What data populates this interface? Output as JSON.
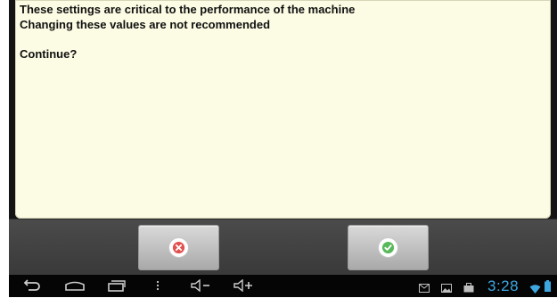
{
  "dialog": {
    "lines": [
      "These settings are critical to the performance of the machine",
      "Changing these values are not recommended"
    ],
    "question": "Continue?"
  },
  "buttons": {
    "cancel_icon": "cancel-x-icon",
    "confirm_icon": "confirm-check-icon"
  },
  "navbar": {
    "icons": [
      "back-icon",
      "home-icon",
      "recent-apps-icon",
      "menu-icon",
      "volume-down-icon",
      "volume-up-icon"
    ]
  },
  "status": {
    "time": "3:28",
    "icons": [
      "email-icon",
      "gallery-icon",
      "briefcase-icon",
      "wifi-icon",
      "battery-icon"
    ]
  },
  "colors": {
    "dialog_bg": "#fcfbe3",
    "cancel_accent": "#e2514f",
    "confirm_accent": "#58b85a",
    "clock": "#3ea7e0"
  }
}
